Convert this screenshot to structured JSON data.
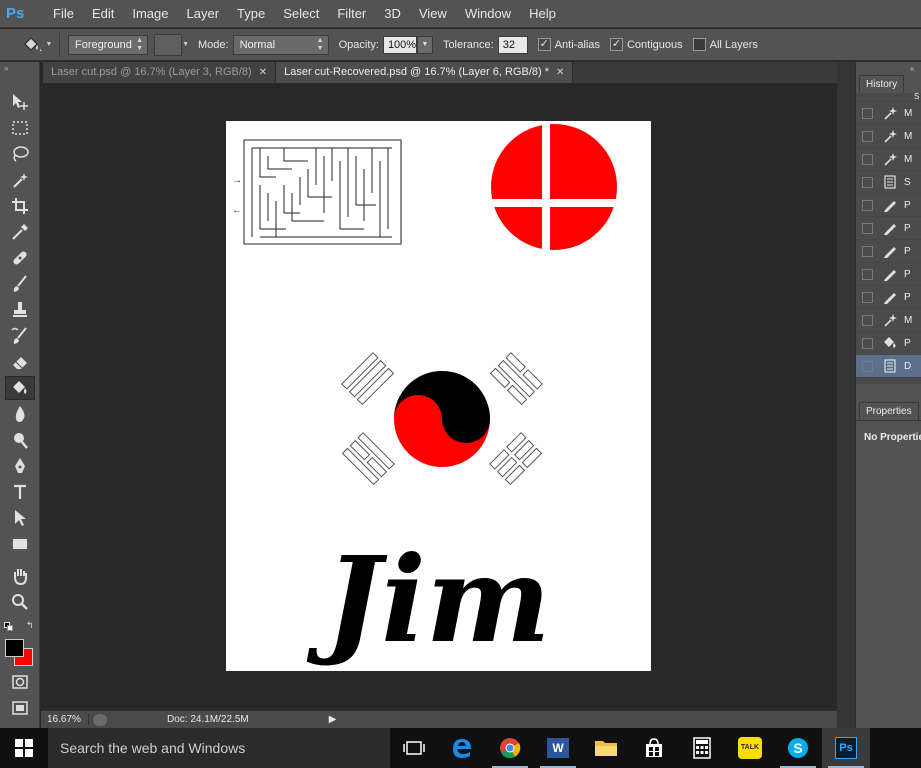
{
  "app": {
    "logo": "Ps"
  },
  "menu": [
    "File",
    "Edit",
    "Image",
    "Layer",
    "Type",
    "Select",
    "Filter",
    "3D",
    "View",
    "Window",
    "Help"
  ],
  "options": {
    "tool_icon": "paint-bucket-icon",
    "fill_source": "Foreground",
    "mode_label": "Mode:",
    "mode_value": "Normal",
    "opacity_label": "Opacity:",
    "opacity_value": "100%",
    "tolerance_label": "Tolerance:",
    "tolerance_value": "32",
    "anti_alias_label": "Anti-alias",
    "anti_alias_checked": true,
    "contiguous_label": "Contiguous",
    "contiguous_checked": true,
    "all_layers_label": "All Layers",
    "all_layers_checked": false
  },
  "tabs": [
    {
      "label": "Laser cut.psd @ 16.7% (Layer 3, RGB/8)",
      "active": false
    },
    {
      "label": "Laser cut-Recovered.psd @ 16.7% (Layer 6, RGB/8) *",
      "active": true
    }
  ],
  "document": {
    "text": "Jim",
    "accent_red": "#ff0000",
    "text_color": "#000000"
  },
  "status": {
    "zoom": "16.67%",
    "doc_info": "Doc: 24.1M/22.5M"
  },
  "panels": {
    "history_tab": "History",
    "history_items": [
      {
        "icon": "magic-wand-icon",
        "label": "M"
      },
      {
        "icon": "magic-wand-icon",
        "label": "M"
      },
      {
        "icon": "magic-wand-icon",
        "label": "M"
      },
      {
        "icon": "document-icon",
        "label": "S"
      },
      {
        "icon": "pencil-icon",
        "label": "P"
      },
      {
        "icon": "pencil-icon",
        "label": "P"
      },
      {
        "icon": "pencil-icon",
        "label": "P"
      },
      {
        "icon": "pencil-icon",
        "label": "P"
      },
      {
        "icon": "pencil-icon",
        "label": "P"
      },
      {
        "icon": "magic-wand-icon",
        "label": "M"
      },
      {
        "icon": "paint-bucket-icon",
        "label": "P"
      },
      {
        "icon": "document-icon",
        "label": "D"
      }
    ],
    "history_partial_top_label": "S",
    "properties_tab": "Properties",
    "properties_body": "No Properties"
  },
  "colors": {
    "foreground": "#000000",
    "background": "#ff0000"
  },
  "taskbar": {
    "search_placeholder": "Search the web and Windows",
    "icons": [
      "task-view-icon",
      "edge-icon",
      "chrome-icon",
      "word-icon",
      "file-explorer-icon",
      "store-icon",
      "calculator-icon",
      "kakaotalk-icon",
      "skype-icon",
      "photoshop-icon"
    ],
    "word_label": "W",
    "kakao_label": "TALK",
    "ps_label": "Ps"
  }
}
